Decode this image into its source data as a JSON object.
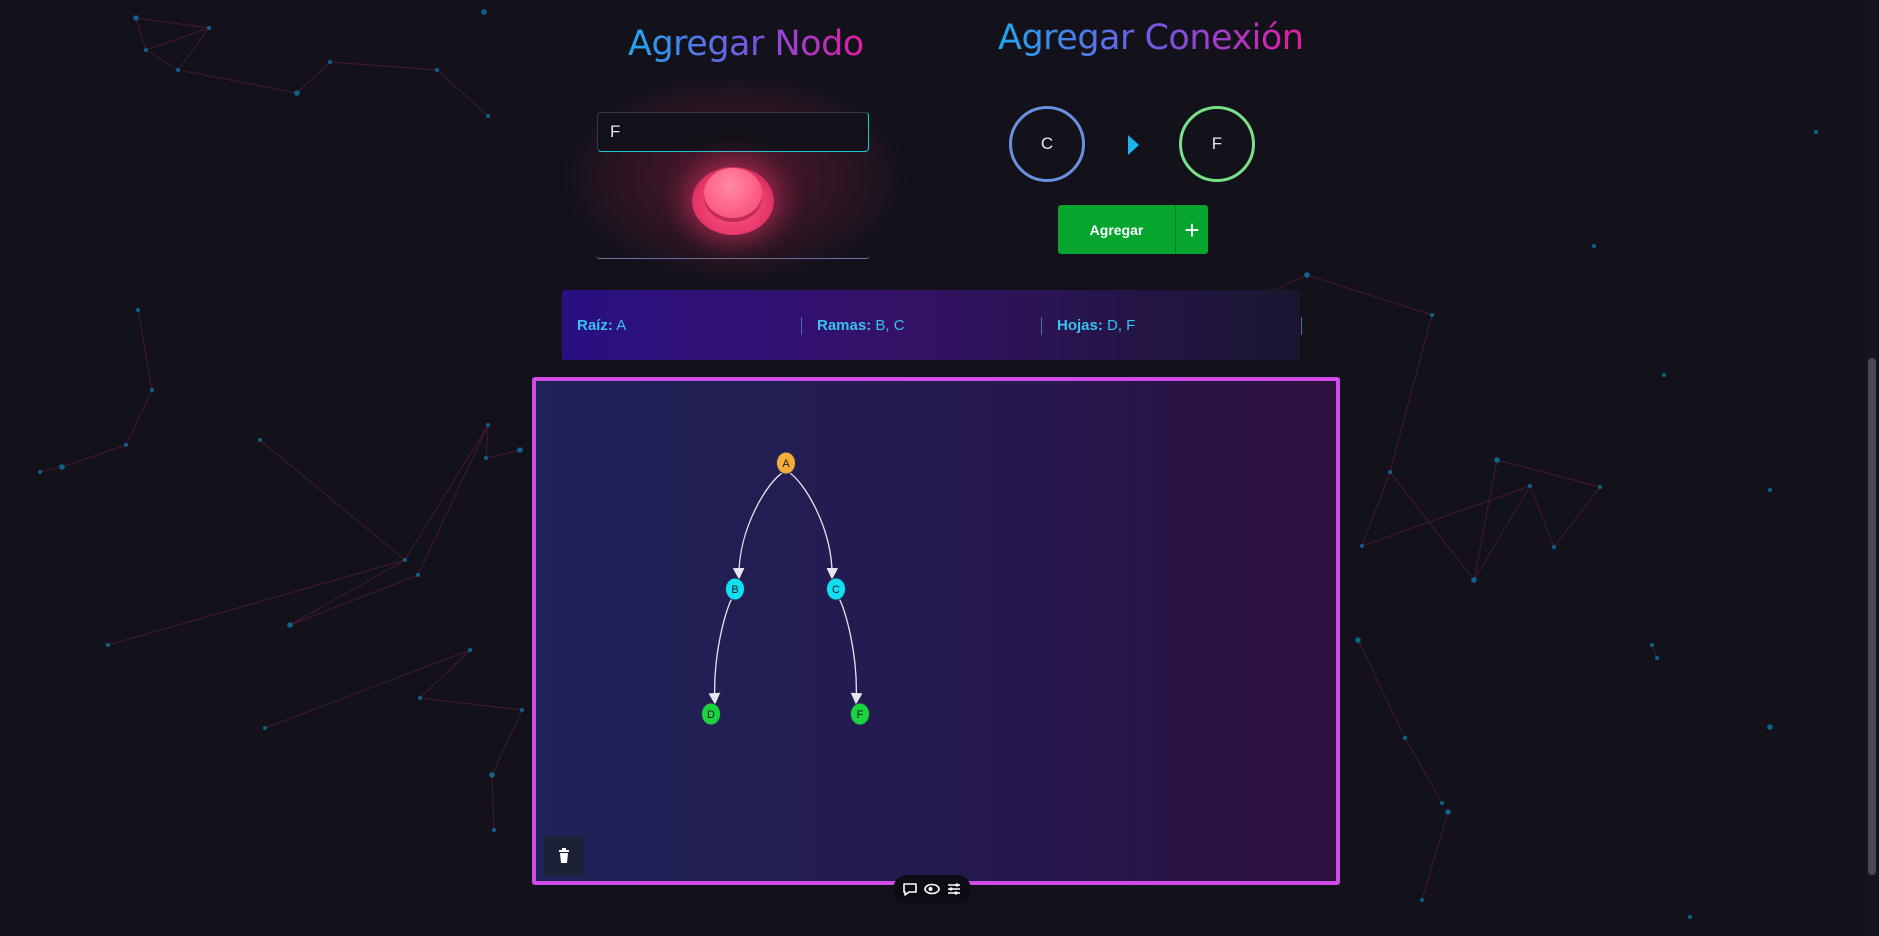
{
  "theme": {
    "background": "#13121b",
    "accent_cyan": "#25c8d6",
    "accent_magenta": "#d04be8",
    "button_green": "#06a52e",
    "button_red": "#ff5c86"
  },
  "add_node": {
    "title": "Agregar Nodo",
    "input_value": "F",
    "submit_icon": "red-push-button"
  },
  "add_connection": {
    "title": "Agregar Conexión",
    "from_node": "C",
    "to_node": "F",
    "arrow_icon": "play-arrow-icon",
    "button_label": "Agregar",
    "button_plus": "+"
  },
  "summary": {
    "root_label": "Raíz:",
    "root_value": "A",
    "branches_label": "Ramas:",
    "branches_value": "B, C",
    "leaves_label": "Hojas:",
    "leaves_value": "D, F"
  },
  "graph": {
    "nodes": [
      {
        "id": "A",
        "role": "root",
        "color": "#f4ad3a"
      },
      {
        "id": "B",
        "role": "branch",
        "color": "#12e0f0"
      },
      {
        "id": "C",
        "role": "branch",
        "color": "#12e0f0"
      },
      {
        "id": "D",
        "role": "leaf",
        "color": "#1bd33e"
      },
      {
        "id": "F",
        "role": "leaf",
        "color": "#1bd33e"
      }
    ],
    "edges": [
      {
        "from": "A",
        "to": "B"
      },
      {
        "from": "A",
        "to": "C"
      },
      {
        "from": "B",
        "to": "D"
      },
      {
        "from": "C",
        "to": "F"
      }
    ],
    "edge_color": "#e6e6ef"
  },
  "controls": {
    "trash_icon": "trash-icon",
    "toolbar_icons": [
      "comment-icon",
      "eye-toggle-icon",
      "settings-list-icon"
    ]
  }
}
